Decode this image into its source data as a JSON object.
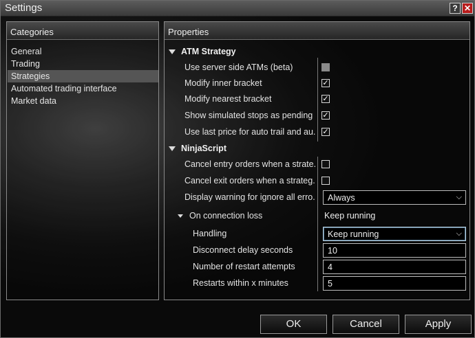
{
  "window": {
    "title": "Settings",
    "help_label": "?",
    "close_label": "✕"
  },
  "categories": {
    "header": "Categories",
    "items": [
      {
        "label": "General"
      },
      {
        "label": "Trading"
      },
      {
        "label": "Strategies",
        "selected": true
      },
      {
        "label": "Automated trading interface"
      },
      {
        "label": "Market data"
      }
    ]
  },
  "properties": {
    "header": "Properties",
    "atm": {
      "title": "ATM Strategy",
      "rows": [
        {
          "label": "Use server side ATMs (beta)",
          "checked": false,
          "disabled": true
        },
        {
          "label": "Modify inner bracket",
          "checked": true
        },
        {
          "label": "Modify nearest bracket",
          "checked": true
        },
        {
          "label": "Show simulated stops as pending",
          "checked": true
        },
        {
          "label": "Use last price for auto trail and au...",
          "checked": true
        }
      ]
    },
    "ninjascript": {
      "title": "NinjaScript",
      "cancel_entry": {
        "label": "Cancel entry orders when a strate...",
        "checked": false
      },
      "cancel_exit": {
        "label": "Cancel exit orders when a strateg...",
        "checked": false
      },
      "display_warning": {
        "label": "Display warning for ignore all erro...",
        "value": "Always"
      },
      "connection_loss": {
        "label": "On connection loss",
        "value": "Keep running",
        "handling": {
          "label": "Handling",
          "value": "Keep running"
        },
        "disconnect_delay": {
          "label": "Disconnect delay seconds",
          "value": "10"
        },
        "restart_attempts": {
          "label": "Number of restart attempts",
          "value": "4"
        },
        "restarts_within": {
          "label": "Restarts within x minutes",
          "value": "5"
        }
      }
    }
  },
  "buttons": {
    "ok": "OK",
    "cancel": "Cancel",
    "apply": "Apply"
  },
  "icons": {
    "check": "✓",
    "dropdown_arrow": "❯"
  }
}
